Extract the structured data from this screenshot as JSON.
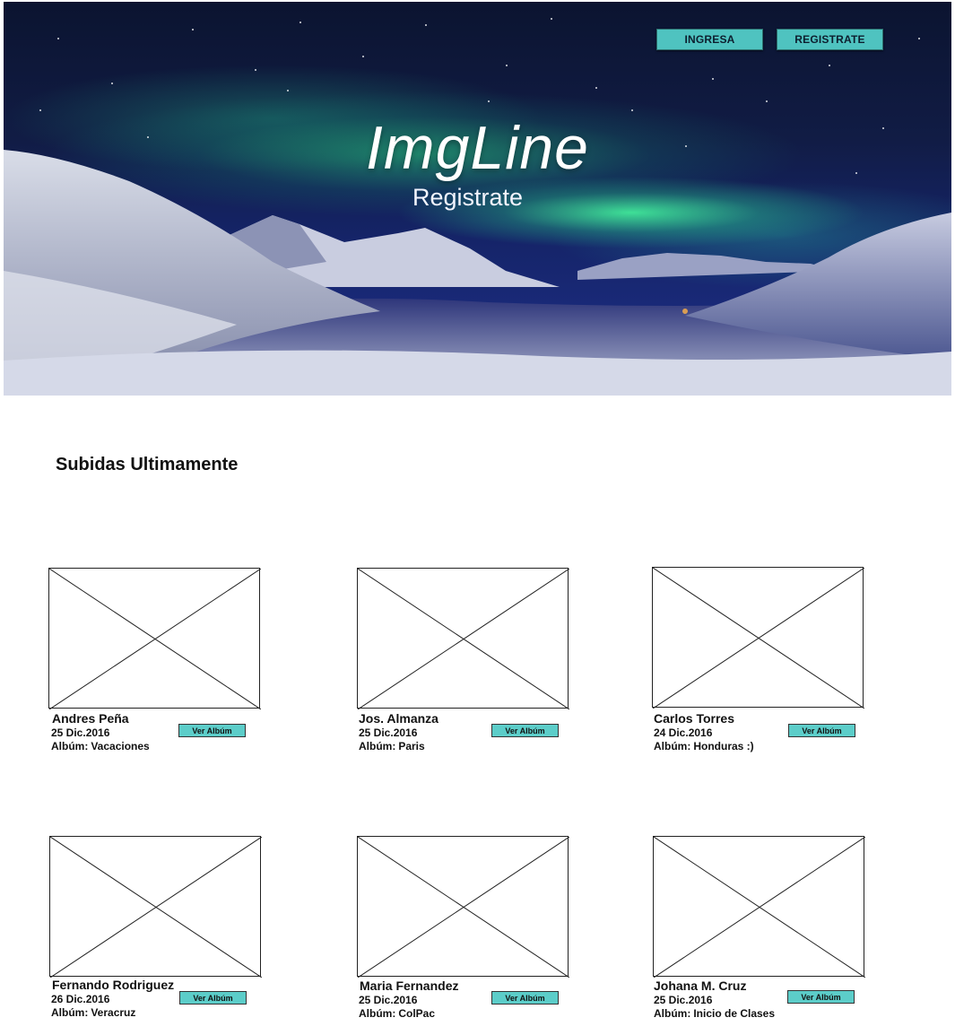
{
  "header": {
    "login_label": "INGRESA",
    "register_label": "REGISTRATE",
    "logo": "ImgLine",
    "subtitle": "Registrate"
  },
  "section": {
    "title": "Subidas Ultimamente"
  },
  "album_prefix": "Albúm:",
  "view_button": "Ver Albúm",
  "cards": [
    {
      "name": "Andres Peña",
      "date": "25 Dic.2016",
      "album": "Vacaciones"
    },
    {
      "name": "Jos. Almanza",
      "date": "25 Dic.2016",
      "album": "Paris"
    },
    {
      "name": "Carlos Torres",
      "date": "24 Dic.2016",
      "album": "Honduras :)"
    },
    {
      "name": "Fernando Rodriguez",
      "date": "26 Dic.2016",
      "album": "Veracruz"
    },
    {
      "name": "Maria Fernandez",
      "date": "25 Dic.2016",
      "album": "ColPac"
    },
    {
      "name": "Johana M. Cruz",
      "date": "25 Dic.2016",
      "album": "Inicio de Clases"
    }
  ],
  "colors": {
    "accent": "#4fc3c0",
    "sky": "#152468",
    "aurora": "#46ffa0"
  }
}
